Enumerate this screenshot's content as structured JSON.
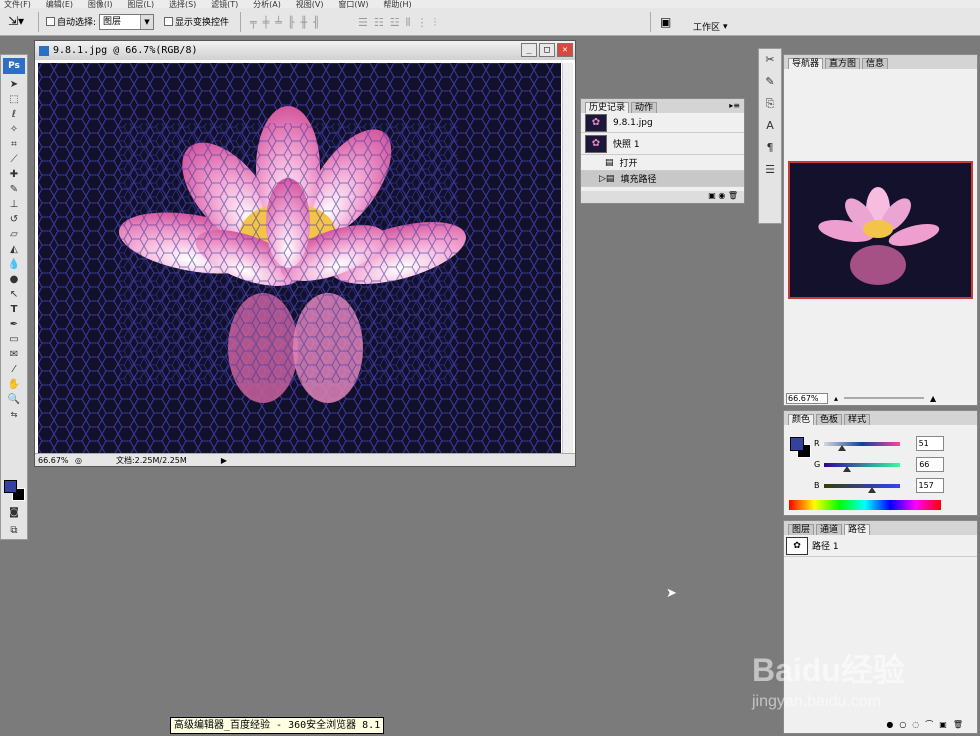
{
  "menubar": [
    "文件(F)",
    "编辑(E)",
    "图像(I)",
    "图层(L)",
    "选择(S)",
    "滤镜(T)",
    "分析(A)",
    "视图(V)",
    "窗口(W)",
    "帮助(H)"
  ],
  "options": {
    "auto_select_label": "自动选择:",
    "auto_select_value": "图层",
    "show_transform_label": "显示变换控件",
    "workspace_label": "工作区"
  },
  "document": {
    "title": "9.8.1.jpg @ 66.7%(RGB/8)",
    "zoom": "66.67%",
    "doc_info": "文档:2.25M/2.25M"
  },
  "history_panel": {
    "tabs": [
      "历史记录",
      "动作"
    ],
    "snapshot_name": "9.8.1.jpg",
    "items": [
      "快照 1",
      "打开",
      "填充路径"
    ]
  },
  "navigator_panel": {
    "tabs": [
      "导航器",
      "直方图",
      "信息"
    ],
    "zoom": "66.67%"
  },
  "color_panel": {
    "tabs": [
      "颜色",
      "色板",
      "样式"
    ],
    "channels": [
      {
        "label": "R",
        "value": "51",
        "fill": 0.2
      },
      {
        "label": "G",
        "value": "66",
        "fill": 0.26
      },
      {
        "label": "B",
        "value": "157",
        "fill": 0.62
      }
    ],
    "foreground": "#33429d",
    "background": "#000000"
  },
  "layers_panel": {
    "tabs": [
      "图层",
      "通道",
      "路径"
    ],
    "path_name": "路径 1"
  },
  "taskbar_tooltip": "高级编辑器_百度经验 - 360安全浏览器 8.1",
  "watermark": {
    "logo": "Baidu经验",
    "url": "jingyan.baidu.com"
  },
  "app_icon": "Ps"
}
